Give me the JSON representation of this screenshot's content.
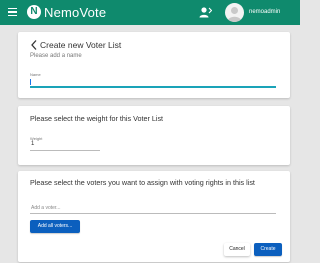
{
  "appbar": {
    "logo_letter": "N",
    "brand": "NemoVote",
    "username": "nemoadmin",
    "colors": {
      "bar": "#0f8a6d"
    }
  },
  "create_card": {
    "title": "Create new Voter List",
    "subtitle": "Please add a name",
    "name_label": "Name",
    "name_value": ""
  },
  "weight_card": {
    "title": "Please select the weight for this Voter List",
    "weight_label": "Weight",
    "weight_value": "1"
  },
  "voters_card": {
    "title": "Please select the voters you want to assign with voting rights in this list",
    "add_voter_placeholder": "Add a voter...",
    "add_all_label": "Add all voters...",
    "cancel_label": "Cancel",
    "create_label": "Create"
  }
}
